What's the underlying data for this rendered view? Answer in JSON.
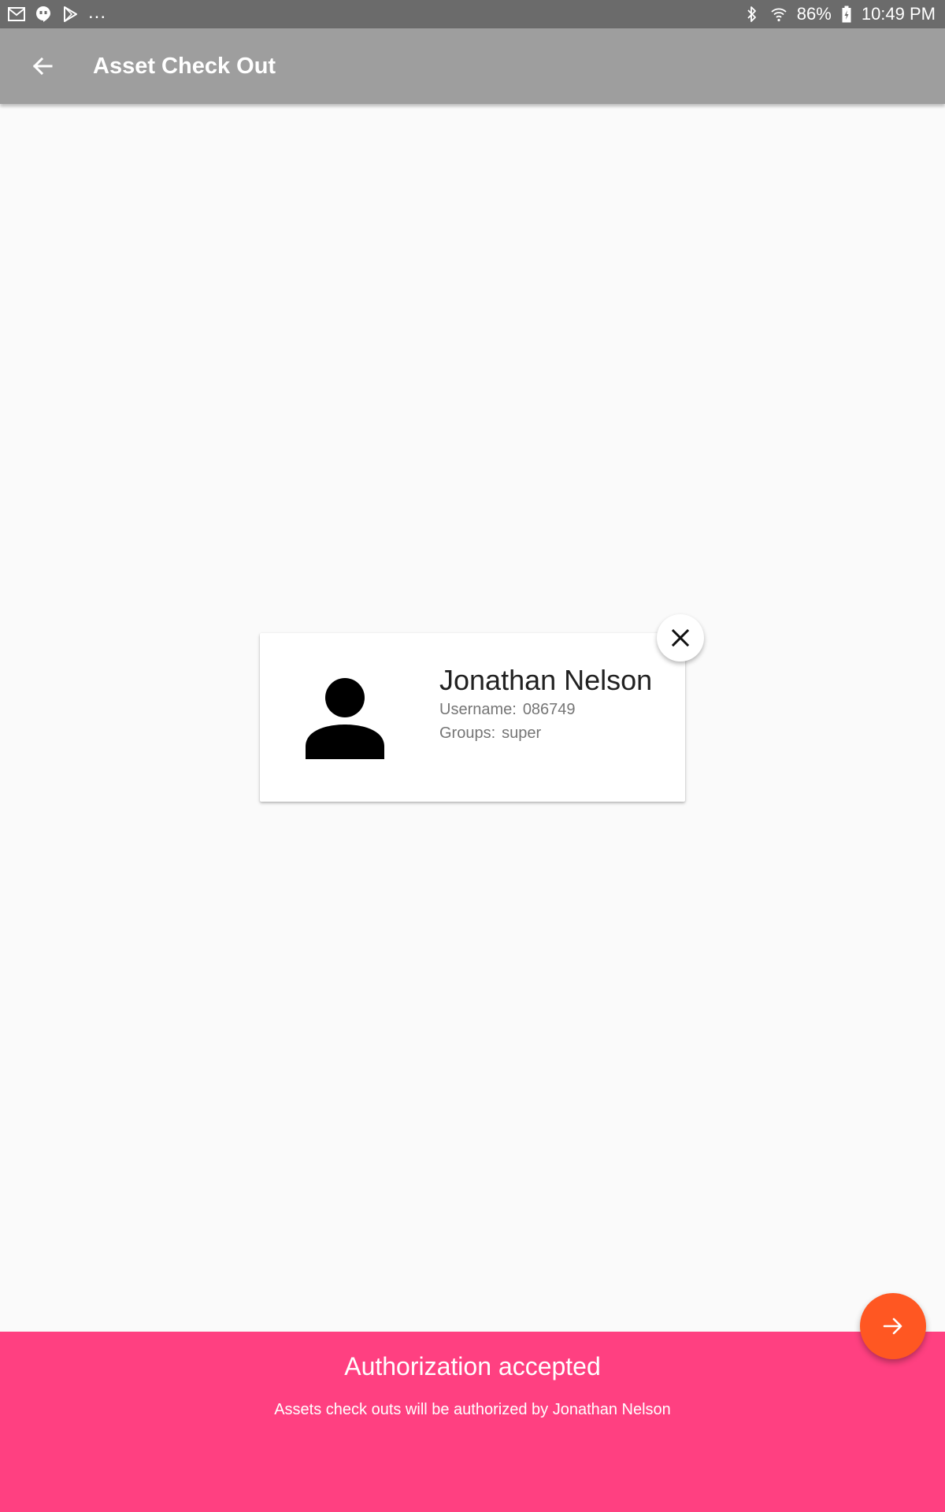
{
  "status_bar": {
    "more": "...",
    "battery": "86%",
    "time": "10:49 PM",
    "icons_left": [
      "gmail-icon",
      "hangouts-icon",
      "play-store-icon"
    ],
    "icons_right": [
      "bluetooth-icon",
      "wifi-icon",
      "battery-charging-icon"
    ]
  },
  "app_bar": {
    "title": "Asset Check Out",
    "back_icon": "arrow-left-icon",
    "background": "#9e9e9e"
  },
  "user_card": {
    "name": "Jonathan Nelson",
    "username_label": "Username:",
    "username": "086749",
    "groups_label": "Groups:",
    "groups": "super",
    "avatar_icon": "person-icon",
    "close_icon": "close-icon"
  },
  "snackbar": {
    "title": "Authorization accepted",
    "message": "Assets check outs will be authorized by Jonathan Nelson",
    "background": "#ff4081"
  },
  "fab": {
    "icon": "arrow-right-icon",
    "background": "#ff5722"
  }
}
